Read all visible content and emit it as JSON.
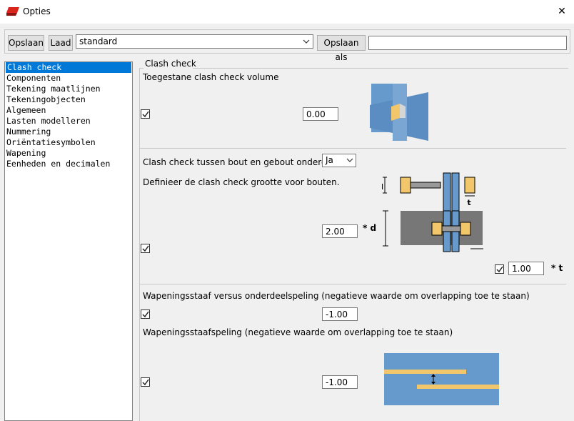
{
  "window": {
    "title": "Opties",
    "icon": "red-app-icon",
    "close_icon": "close-icon"
  },
  "toolbar": {
    "save_label": "Opslaan",
    "load_label": "Laad",
    "preset_value": "standard",
    "save_as_label": "Opslaan als",
    "save_as_name": ""
  },
  "sidebar": {
    "items": [
      {
        "label": "Clash check",
        "selected": true
      },
      {
        "label": "Componenten"
      },
      {
        "label": "Tekening maatlijnen"
      },
      {
        "label": "Tekeningobjecten"
      },
      {
        "label": "Algemeen"
      },
      {
        "label": "Lasten modelleren"
      },
      {
        "label": "Nummering"
      },
      {
        "label": "Oriëntatiesymbolen"
      },
      {
        "label": "Wapening"
      },
      {
        "label": "Eenheden en decimalen"
      }
    ]
  },
  "clash_check": {
    "group_title": "Clash check",
    "volume_label": "Toegestane clash check volume",
    "volume_checked": true,
    "volume_value": "0.00",
    "bolt_label": "Clash check tussen bout en gebout onderdeel:",
    "bolt_option": "Ja",
    "bolt_size_label": "Definieer de clash check grootte voor bouten.",
    "bolt_checked": true,
    "bolt_d_value": "2.00",
    "bolt_d_suffix": "* d",
    "bolt_t_checked": true,
    "bolt_t_value": "1.00",
    "bolt_t_suffix": "* t",
    "diagram_d": "d",
    "diagram_t": "t",
    "rebar_part_label": "Wapeningsstaaf versus onderdeelspeling (negatieve waarde om overlapping toe te staan)",
    "rebar_part_checked": true,
    "rebar_part_value": "-1.00",
    "rebar_gap_label": "Wapeningsstaafspeling (negatieve waarde om overlapping toe te staan)",
    "rebar_gap_checked": true,
    "rebar_gap_value": "-1.00"
  },
  "colors": {
    "selection": "#0078d7",
    "diagram_blue": "#6699cc",
    "bolt_yellow": "#f2c76b"
  }
}
